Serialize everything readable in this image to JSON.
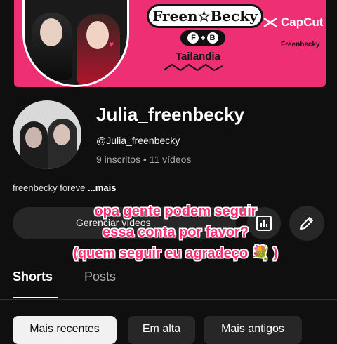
{
  "banner": {
    "title": "Freen☆Becky",
    "badge_left": "F",
    "badge_plus": "+",
    "badge_right": "B",
    "country": "Tailandia",
    "handle": "Freenbecky"
  },
  "watermark": {
    "label": "CapCut"
  },
  "channel": {
    "name": "Julia_freenbecky",
    "handle": "@Julia_freenbecky",
    "stats": "9 inscritos • 11 vídeos",
    "description": "freenbecky foreve",
    "more_label": "...mais"
  },
  "actions": {
    "manage_label": "Gerenciar vídeos"
  },
  "overlay": {
    "line1": "opa gente podem seguir",
    "line2": "essa conta por favor?",
    "line3": "(quem seguir eu agradeço 💐 )"
  },
  "tabs": [
    {
      "label": "Shorts"
    },
    {
      "label": "Posts"
    }
  ],
  "chips": [
    {
      "label": "Mais recentes"
    },
    {
      "label": "Em alta"
    },
    {
      "label": "Mais antigos"
    }
  ],
  "colors": {
    "background": "#0f0f0f",
    "banner_pink": "#ee2f73",
    "overlay_pink": "#ff2d73",
    "button_gray": "#272727"
  }
}
